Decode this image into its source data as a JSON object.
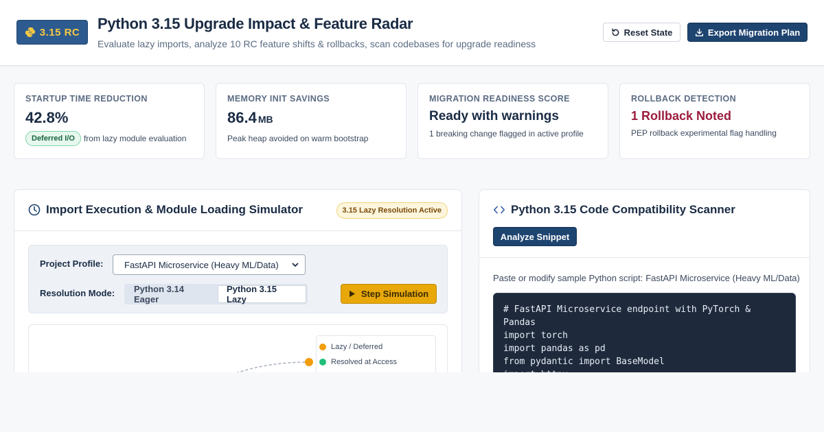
{
  "header": {
    "version": "3.15 RC",
    "title": "Python 3.15 Upgrade Impact & Feature Radar",
    "subtitle": "Evaluate lazy imports, analyze 10 RC feature shifts & rollbacks, scan codebases for upgrade readiness",
    "reset_label": "Reset State",
    "export_label": "Export Migration Plan",
    "brand_color": "#1e4470",
    "accent_color": "#f5c842"
  },
  "metrics": [
    {
      "label": "Startup Time Reduction",
      "value": "42.8%",
      "pill": "Deferred I/O",
      "note": "from lazy module evaluation"
    },
    {
      "label": "Memory Init Savings",
      "value": "86.4",
      "unit": "MB",
      "note": "Peak heap avoided on warm bootstrap"
    },
    {
      "label": "Migration Readiness Score",
      "value": "Ready with warnings",
      "note": "1 breaking change flagged in active profile"
    },
    {
      "label": "Rollback Detection",
      "value": "1 Rollback Noted",
      "note": "PEP rollback experimental flag handling"
    }
  ],
  "simulator": {
    "title": "Import Execution & Module Loading Simulator",
    "badge": "3.15 Lazy Resolution Active",
    "profile_label": "Project Profile:",
    "profile_value": "FastAPI Microservice (Heavy ML/Data)",
    "mode_label": "Resolution Mode:",
    "modes": [
      "Python 3.14 Eager",
      "Python 3.15 Lazy"
    ],
    "active_mode": "Python 3.15 Lazy",
    "step_label": "Step Simulation",
    "legend": [
      {
        "label": "Lazy / Deferred",
        "color": "#f29d0c"
      },
      {
        "label": "Resolved at Access",
        "color": "#1fbf7a"
      }
    ]
  },
  "scanner": {
    "title": "Python 3.15 Code Compatibility Scanner",
    "analyze_label": "Analyze Snippet",
    "paste_label": "Paste or modify sample Python script:",
    "paste_profile": "FastAPI Microservice (Heavy ML/Data)",
    "code": [
      "# FastAPI Microservice endpoint with PyTorch & Pandas",
      "import torch",
      "import pandas as pd",
      "from pydantic import BaseModel",
      "import httpx"
    ]
  }
}
